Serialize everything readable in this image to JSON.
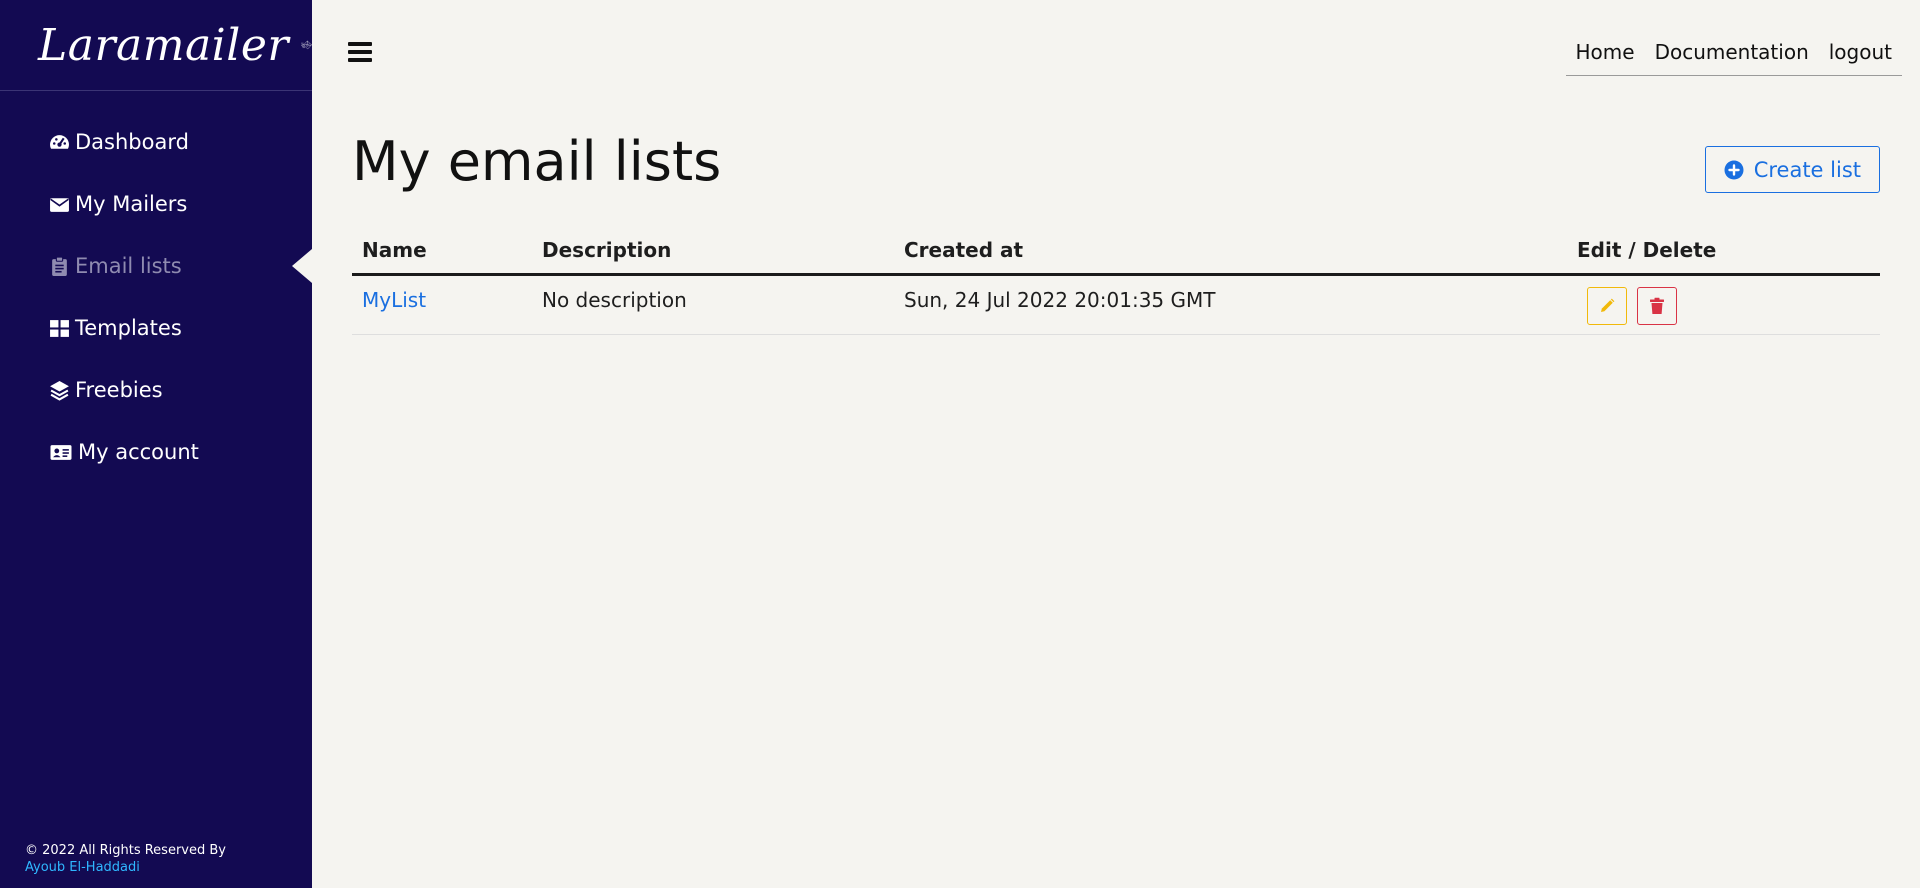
{
  "brand": {
    "name": "Laramailer",
    "logo_icon": "flying-envelope-icon"
  },
  "sidebar": {
    "items": [
      {
        "label": "Dashboard",
        "icon": "gauge-icon",
        "active": false
      },
      {
        "label": "My Mailers",
        "icon": "envelope-icon",
        "active": false
      },
      {
        "label": "Email lists",
        "icon": "clipboard-list-icon",
        "active": true
      },
      {
        "label": "Templates",
        "icon": "grid-icon",
        "active": false
      },
      {
        "label": "Freebies",
        "icon": "layers-icon",
        "active": false
      },
      {
        "label": "My account",
        "icon": "id-card-icon",
        "active": false
      }
    ],
    "footer": {
      "copyright": "© 2022 All Rights Reserved By",
      "author": "Ayoub El-Haddadi"
    }
  },
  "topnav": {
    "home": "Home",
    "documentation": "Documentation",
    "logout": "logout"
  },
  "page": {
    "title": "My email lists",
    "create_button": "Create list"
  },
  "table": {
    "headers": [
      "Name",
      "Description",
      "Created at",
      "Edit / Delete"
    ],
    "rows": [
      {
        "name": "MyList",
        "description": "No description",
        "created_at": "Sun, 24 Jul 2022 20:01:35 GMT"
      }
    ]
  },
  "colors": {
    "sidebar_bg": "#130a52",
    "page_bg": "#f5f4f0",
    "accent_blue": "#1a6fe0",
    "edit_yellow": "#f1b90a",
    "delete_red": "#d93345",
    "author_link": "#2fb7ff"
  }
}
